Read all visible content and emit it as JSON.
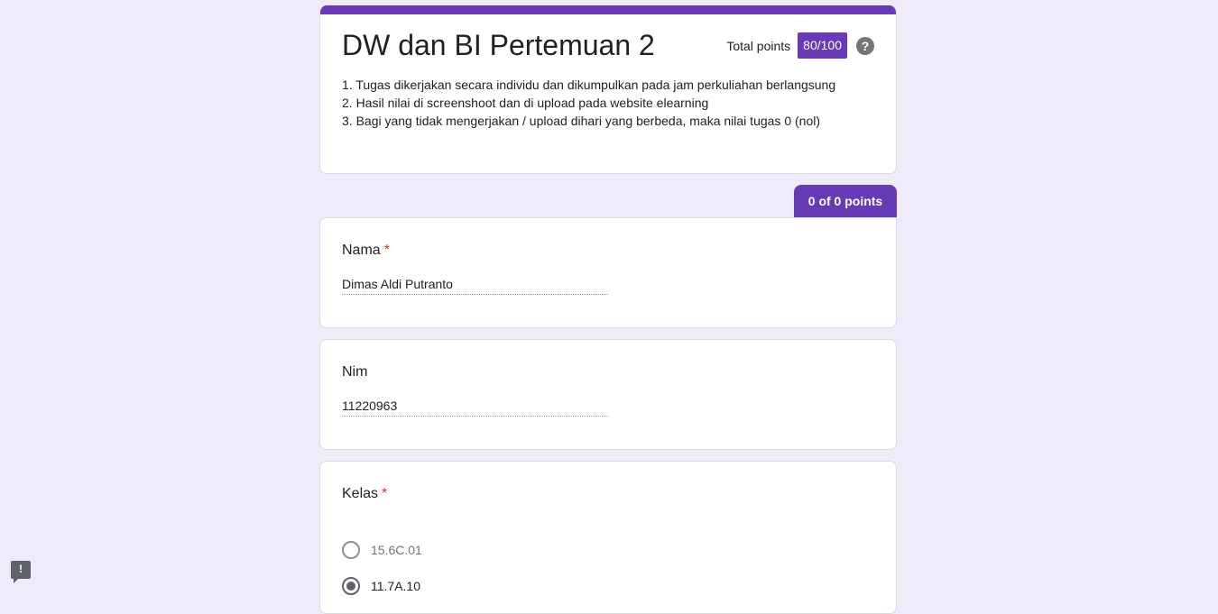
{
  "form": {
    "title": "DW dan BI Pertemuan 2",
    "total_points_label": "Total points",
    "total_points_value": "80/100",
    "help_icon": "help-circle-icon",
    "description": [
      "1. Tugas dikerjakan secara individu dan dikumpulkan pada jam perkuliahan berlangsung",
      "2. Hasil nilai di screenshoot dan di upload pada website elearning",
      "3. Bagi yang tidak mengerjakan / upload dihari yang berbeda, maka nilai tugas 0 (nol)"
    ],
    "accent_color": "#673ab7",
    "background_color": "#f0ebf8"
  },
  "section": {
    "points_tab": "0 of 0 points"
  },
  "questions": {
    "nama": {
      "label": "Nama",
      "required_mark": "*",
      "answer": "Dimas Aldi Putranto"
    },
    "nim": {
      "label": "Nim",
      "answer": "11220963"
    },
    "kelas": {
      "label": "Kelas",
      "required_mark": "*",
      "options": [
        {
          "label": "15.6C.01",
          "selected": false
        },
        {
          "label": "11.7A.10",
          "selected": true
        }
      ]
    }
  },
  "feedback": {
    "icon": "report-feedback-icon",
    "glyph": "!"
  }
}
